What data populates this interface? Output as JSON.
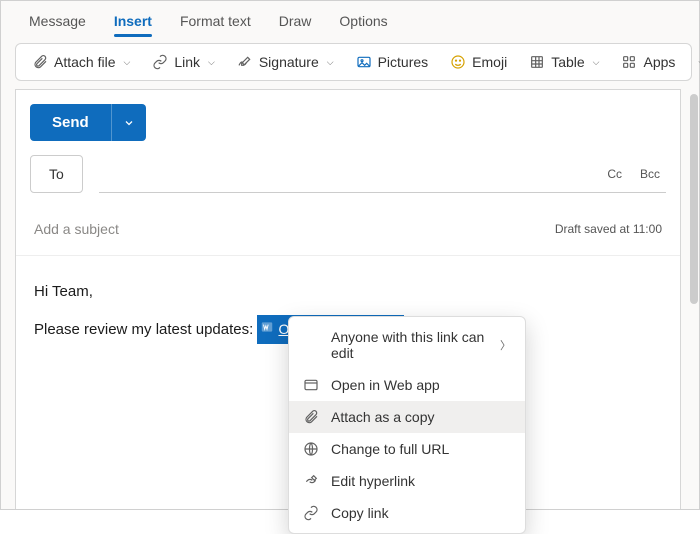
{
  "tabs": {
    "message": "Message",
    "insert": "Insert",
    "format": "Format text",
    "draw": "Draw",
    "options": "Options"
  },
  "toolbar": {
    "attach": "Attach file",
    "link": "Link",
    "signature": "Signature",
    "pictures": "Pictures",
    "emoji": "Emoji",
    "table": "Table",
    "apps": "Apps"
  },
  "send": {
    "label": "Send"
  },
  "recipients": {
    "to_label": "To",
    "cc_label": "Cc",
    "bcc_label": "Bcc"
  },
  "subject": {
    "placeholder": "Add a subject",
    "draft_status": "Draft saved at 11:00"
  },
  "body": {
    "line1": "Hi Team,",
    "line2_prefix": "Please review my latest updates: ",
    "attachment_name": "OfficeToolTips.docx"
  },
  "context_menu": {
    "anyone": "Anyone with this link can edit",
    "open_web": "Open in Web app",
    "attach_copy": "Attach as a copy",
    "full_url": "Change to full URL",
    "edit_hyperlink": "Edit hyperlink",
    "copy_link": "Copy link"
  }
}
